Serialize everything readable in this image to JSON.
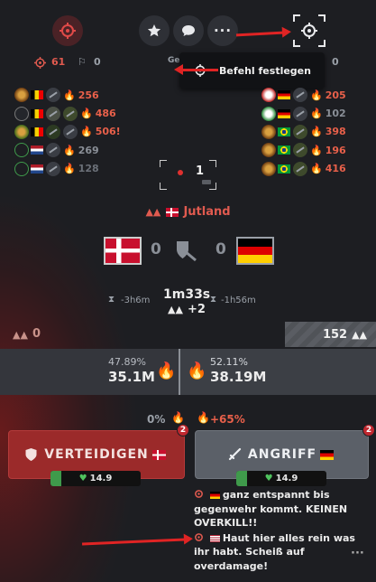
{
  "colors": {
    "accent_red": "#e05a4f",
    "fire": "#e8604a",
    "bg": "#1d1e22",
    "green_hp": "#3f9a4b"
  },
  "topbar": {
    "left_icon": "crosshair-icon",
    "star_icon": "star-icon",
    "chat_icon": "chat-icon",
    "more_label": "···",
    "target_icon": "crosshair-icon"
  },
  "stats": {
    "left_kills": "61",
    "left_troops": "0",
    "center_fragment": "Ge",
    "right_troops": "0"
  },
  "tooltip": {
    "label": "Befehl festlegen"
  },
  "left_players": [
    {
      "value": "256",
      "warn": false
    },
    {
      "value": "486",
      "warn": false
    },
    {
      "value": "506!",
      "warn": false
    },
    {
      "value": "269",
      "warn": false
    },
    {
      "value": "128",
      "warn": false
    }
  ],
  "right_players": [
    {
      "value": "205"
    },
    {
      "value": "102"
    },
    {
      "value": "398"
    },
    {
      "value": "196"
    },
    {
      "value": "416"
    }
  ],
  "objective": {
    "count": "1"
  },
  "location": {
    "name": "Jutland"
  },
  "versus": {
    "left_score": "0",
    "right_score": "0"
  },
  "timer": {
    "main": "1m33s",
    "left": "-3h6m",
    "right": "-1h56m",
    "delta": "+2"
  },
  "troops": {
    "left": "0",
    "right": "152"
  },
  "strength": {
    "left_pct": "47.89%",
    "left_value": "35.1M",
    "right_pct": "52.11%",
    "right_value": "38.19M"
  },
  "bonus": {
    "left": "0%",
    "right": "+65%"
  },
  "actions": {
    "defend_label": "VERTEIDIGEN",
    "defend_badge": "2",
    "attack_label": "ANGRIFF",
    "attack_badge": "2",
    "defend_hp": "14.9",
    "attack_hp": "14.9"
  },
  "chat": {
    "messages": [
      {
        "text": "ganz entspannt bis gegenwehr kommt. KEINEN OVERKILL!!"
      },
      {
        "text": "Haut hier alles rein was ihr habt. Scheiß auf overdamage!"
      }
    ],
    "more_label": "···"
  }
}
